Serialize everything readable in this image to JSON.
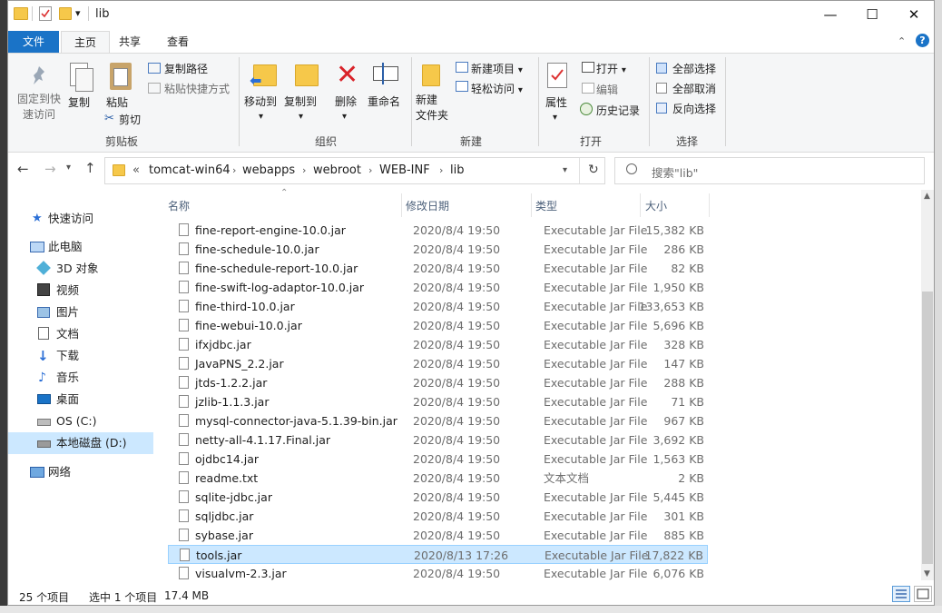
{
  "window": {
    "title": "lib",
    "quick_access_dropdown": "▾",
    "minimize": "—",
    "maximize": "☐",
    "close": "✕"
  },
  "ribbon_tabs": {
    "file": "文件",
    "home": "主页",
    "share": "共享",
    "view": "查看"
  },
  "ribbon": {
    "clipboard": {
      "pin_quick_access": "固定到快\n速访问",
      "copy": "复制",
      "paste": "粘贴",
      "copy_path": "复制路径",
      "paste_shortcut": "粘贴快捷方式",
      "cut": "剪切",
      "group": "剪贴板"
    },
    "organize": {
      "move_to": "移动到",
      "copy_to": "复制到",
      "delete": "删除",
      "rename": "重命名",
      "group": "组织"
    },
    "new": {
      "new_folder": "新建\n文件夹",
      "new_item": "新建项目",
      "easy_access": "轻松访问",
      "group": "新建"
    },
    "open": {
      "properties": "属性",
      "open": "打开",
      "edit": "编辑",
      "history": "历史记录",
      "group": "打开"
    },
    "select": {
      "select_all": "全部选择",
      "select_none": "全部取消",
      "invert": "反向选择",
      "group": "选择"
    }
  },
  "address": {
    "overflow": "«",
    "crumbs": [
      "tomcat-win64",
      "webapps",
      "webroot",
      "WEB-INF",
      "lib"
    ],
    "search_placeholder": "搜索\"lib\""
  },
  "nav": {
    "quick_access": "快速访问",
    "this_pc": "此电脑",
    "objects_3d": "3D 对象",
    "videos": "视频",
    "pictures": "图片",
    "documents": "文档",
    "downloads": "下载",
    "music": "音乐",
    "desktop": "桌面",
    "os_c": "OS (C:)",
    "local_d": "本地磁盘 (D:)",
    "network": "网络"
  },
  "columns": {
    "name": "名称",
    "date": "修改日期",
    "type": "类型",
    "size": "大小"
  },
  "files": [
    {
      "name": "fine-report-engine-10.0.jar",
      "date": "2020/8/4 19:50",
      "type": "Executable Jar File",
      "size": "15,382 KB"
    },
    {
      "name": "fine-schedule-10.0.jar",
      "date": "2020/8/4 19:50",
      "type": "Executable Jar File",
      "size": "286 KB"
    },
    {
      "name": "fine-schedule-report-10.0.jar",
      "date": "2020/8/4 19:50",
      "type": "Executable Jar File",
      "size": "82 KB"
    },
    {
      "name": "fine-swift-log-adaptor-10.0.jar",
      "date": "2020/8/4 19:50",
      "type": "Executable Jar File",
      "size": "1,950 KB"
    },
    {
      "name": "fine-third-10.0.jar",
      "date": "2020/8/4 19:50",
      "type": "Executable Jar File",
      "size": "133,653 KB"
    },
    {
      "name": "fine-webui-10.0.jar",
      "date": "2020/8/4 19:50",
      "type": "Executable Jar File",
      "size": "5,696 KB"
    },
    {
      "name": "ifxjdbc.jar",
      "date": "2020/8/4 19:50",
      "type": "Executable Jar File",
      "size": "328 KB"
    },
    {
      "name": "JavaPNS_2.2.jar",
      "date": "2020/8/4 19:50",
      "type": "Executable Jar File",
      "size": "147 KB"
    },
    {
      "name": "jtds-1.2.2.jar",
      "date": "2020/8/4 19:50",
      "type": "Executable Jar File",
      "size": "288 KB"
    },
    {
      "name": "jzlib-1.1.3.jar",
      "date": "2020/8/4 19:50",
      "type": "Executable Jar File",
      "size": "71 KB"
    },
    {
      "name": "mysql-connector-java-5.1.39-bin.jar",
      "date": "2020/8/4 19:50",
      "type": "Executable Jar File",
      "size": "967 KB"
    },
    {
      "name": "netty-all-4.1.17.Final.jar",
      "date": "2020/8/4 19:50",
      "type": "Executable Jar File",
      "size": "3,692 KB"
    },
    {
      "name": "ojdbc14.jar",
      "date": "2020/8/4 19:50",
      "type": "Executable Jar File",
      "size": "1,563 KB"
    },
    {
      "name": "readme.txt",
      "date": "2020/8/4 19:50",
      "type": "文本文档",
      "size": "2 KB"
    },
    {
      "name": "sqlite-jdbc.jar",
      "date": "2020/8/4 19:50",
      "type": "Executable Jar File",
      "size": "5,445 KB"
    },
    {
      "name": "sqljdbc.jar",
      "date": "2020/8/4 19:50",
      "type": "Executable Jar File",
      "size": "301 KB"
    },
    {
      "name": "sybase.jar",
      "date": "2020/8/4 19:50",
      "type": "Executable Jar File",
      "size": "885 KB"
    },
    {
      "name": "tools.jar",
      "date": "2020/8/13 17:26",
      "type": "Executable Jar File",
      "size": "17,822 KB",
      "selected": true
    },
    {
      "name": "visualvm-2.3.jar",
      "date": "2020/8/4 19:50",
      "type": "Executable Jar File",
      "size": "6,076 KB"
    }
  ],
  "status": {
    "count": "25 个项目",
    "selected": "选中 1 个项目",
    "size": "17.4 MB"
  },
  "colors": {
    "accent": "#1a73c7",
    "selected_row": "#cce8ff",
    "folder": "#f6c84a"
  }
}
